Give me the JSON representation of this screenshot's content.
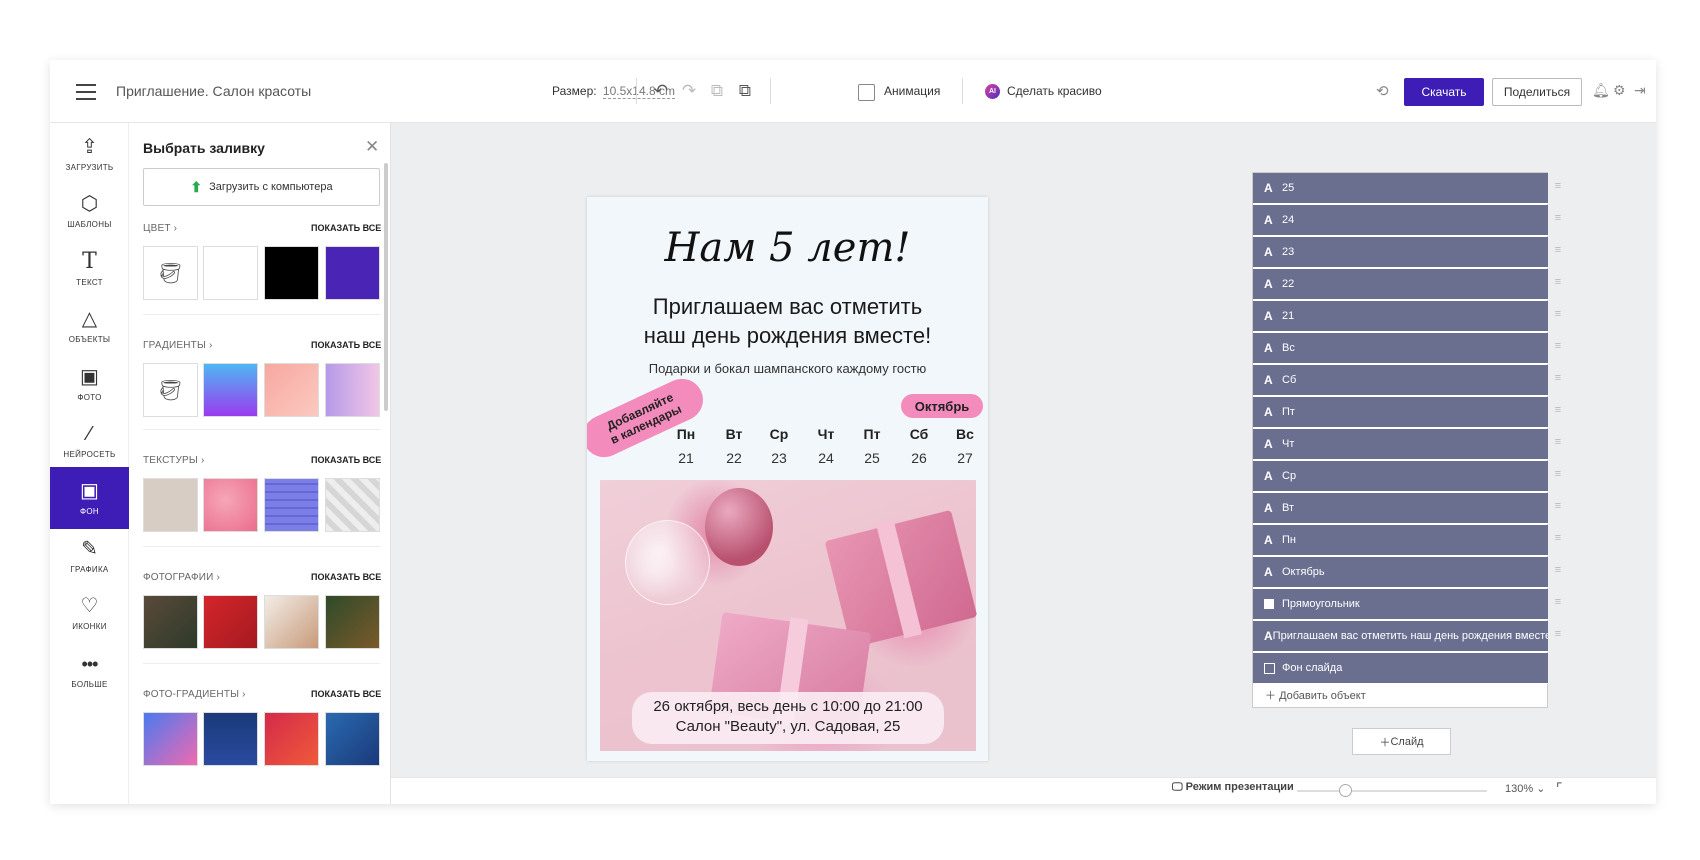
{
  "header": {
    "doc_title": "Приглашение. Салон красоты",
    "size_label": "Размер:",
    "size_value": "10.5x14.8",
    "size_unit": "cm",
    "animation_label": "Анимация",
    "ai_badge": "AI",
    "beautify_label": "Сделать красиво",
    "download_label": "Скачать",
    "share_label": "Поделиться"
  },
  "nav": [
    {
      "label": "ЗАГРУЗИТЬ",
      "icon": "upload-icon"
    },
    {
      "label": "ШАБЛОНЫ",
      "icon": "templates-icon"
    },
    {
      "label": "ТЕКСТ",
      "icon": "text-icon"
    },
    {
      "label": "ОБЪЕКТЫ",
      "icon": "shapes-icon"
    },
    {
      "label": "ФОТО",
      "icon": "photo-icon"
    },
    {
      "label": "НЕЙРОСЕТЬ",
      "icon": "magic-wand-icon"
    },
    {
      "label": "ФОН",
      "icon": "background-icon"
    },
    {
      "label": "ГРАФИКА",
      "icon": "brush-icon"
    },
    {
      "label": "ИКОНКИ",
      "icon": "heart-icon"
    },
    {
      "label": "БОЛЬШЕ",
      "icon": "more-icon"
    }
  ],
  "panel": {
    "title": "Выбрать заливку",
    "upload_label": "Загрузить с компьютера",
    "show_all": "ПОКАЗАТЬ ВСЕ",
    "sections": {
      "color": "ЦВЕТ",
      "gradients": "ГРАДИЕНТЫ",
      "textures": "ТЕКСТУРЫ",
      "photos": "ФОТОГРАФИИ",
      "photo_gradients": "ФОТО-ГРАДИЕНТЫ"
    },
    "colors": [
      "#ffffff",
      "#000000",
      "#4a25b5"
    ]
  },
  "card": {
    "headline": "Нам 5 лет!",
    "subtitle_line1": "Приглашаем вас отметить",
    "subtitle_line2": "наш день рождения вместе!",
    "gifts": "Подарки и бокал шампанского каждому гостю",
    "add_to_calendar_line1": "Добавляйте",
    "add_to_calendar_line2": "в календары",
    "month": "Октябрь",
    "weekdays": [
      "Пн",
      "Вт",
      "Ср",
      "Чт",
      "Пт",
      "Сб",
      "Вс"
    ],
    "days": [
      "21",
      "22",
      "23",
      "24",
      "25",
      "26",
      "27"
    ],
    "date_line1": "26 октября, весь день с 10:00 до 21:00",
    "date_line2": "Салон \"Beauty\", ул. Садовая, 25"
  },
  "layers": {
    "items": [
      {
        "type": "text",
        "label": "25"
      },
      {
        "type": "text",
        "label": "24"
      },
      {
        "type": "text",
        "label": "23"
      },
      {
        "type": "text",
        "label": "22"
      },
      {
        "type": "text",
        "label": "21"
      },
      {
        "type": "text",
        "label": "Вс"
      },
      {
        "type": "text",
        "label": "Сб"
      },
      {
        "type": "text",
        "label": "Пт"
      },
      {
        "type": "text",
        "label": "Чт"
      },
      {
        "type": "text",
        "label": "Ср"
      },
      {
        "type": "text",
        "label": "Вт"
      },
      {
        "type": "text",
        "label": "Пн"
      },
      {
        "type": "text",
        "label": "Октябрь"
      },
      {
        "type": "rect",
        "label": "Прямоугольник"
      },
      {
        "type": "text",
        "label": "Приглашаем вас отметить наш день рождения вместе!"
      },
      {
        "type": "bg",
        "label": "Фон слайда"
      }
    ],
    "text_glyph": "A",
    "add_object": "Добавить объект",
    "add_slide": "Слайд"
  },
  "footer": {
    "presentation_mode": "Режим презентации",
    "zoom": "130%"
  }
}
